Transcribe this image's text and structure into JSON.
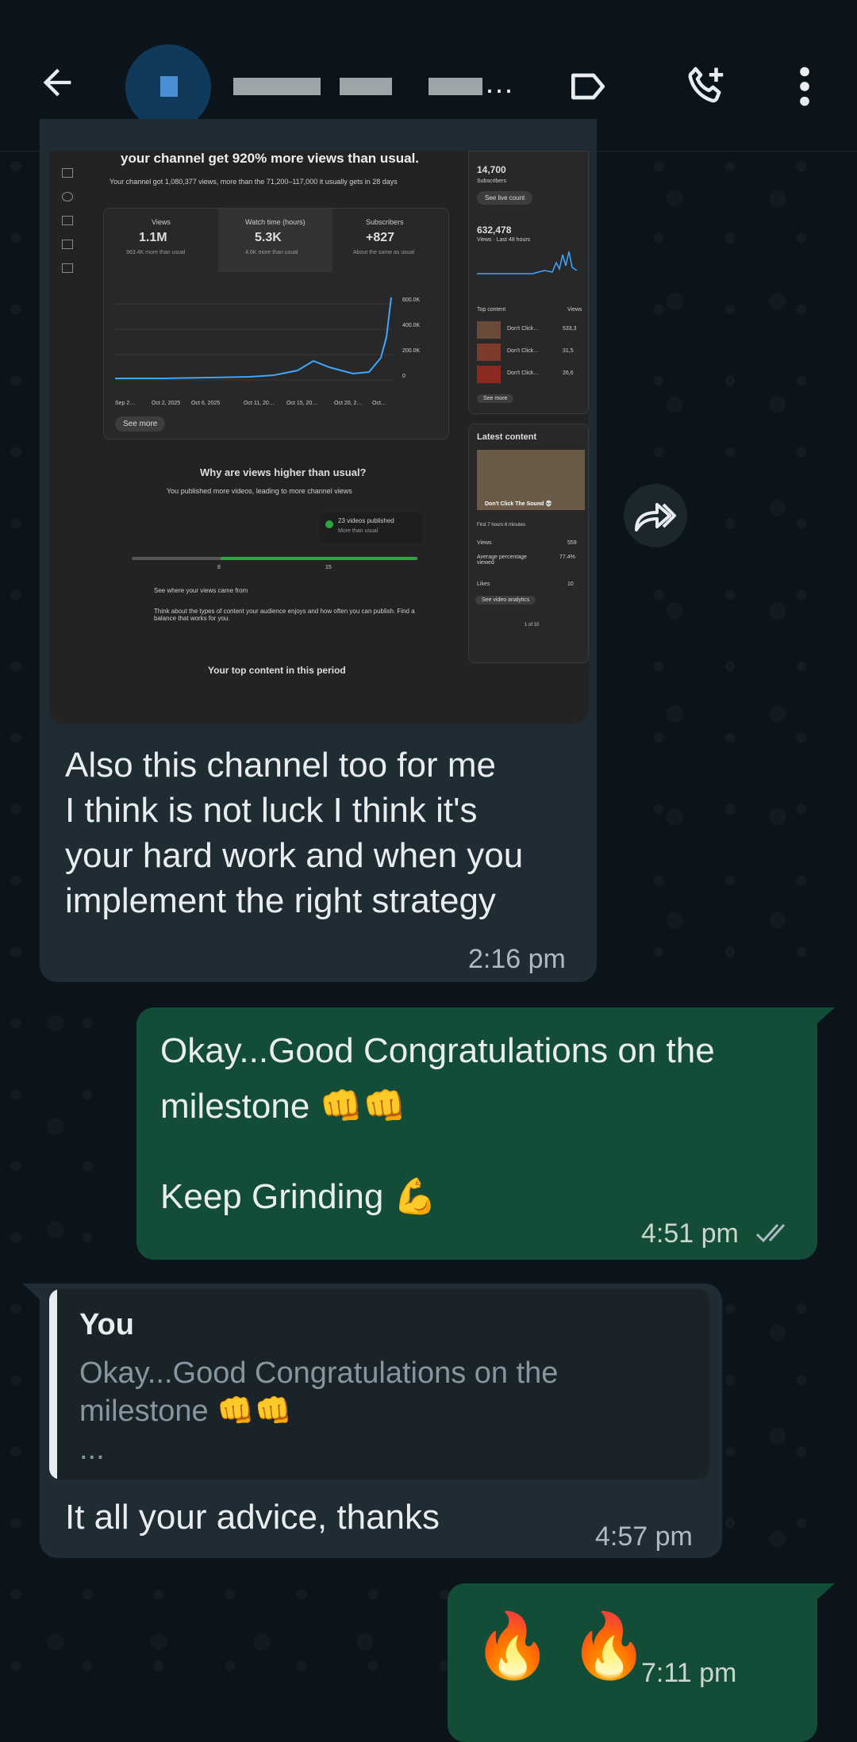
{
  "header": {
    "contact_name_suffix": "…"
  },
  "shared_screenshot": {
    "headline": "your channel get 920% more views than usual.",
    "subline": "Your channel got 1,080,377 views, more than the 71,200–117,000 it usually gets in 28 days",
    "stats": [
      {
        "label": "Views",
        "value": "1.1M",
        "sub": "963.4K more than usual"
      },
      {
        "label": "Watch time (hours)",
        "value": "5.3K",
        "sub": "4.6K more than usual"
      },
      {
        "label": "Subscribers",
        "value": "+827",
        "sub": "About the same as usual"
      }
    ],
    "y_ticks": [
      "600.0K",
      "400.0K",
      "200.0K",
      "0"
    ],
    "x_ticks": [
      "Sep 2…",
      "Oct 2, 2025",
      "Oct 6, 2025",
      "Oct 11, 20…",
      "Oct 15, 20…",
      "Oct 20, 2…",
      "Oct…"
    ],
    "see_more": "See more",
    "why_title": "Why are views higher than usual?",
    "why_sub": "You published more videos, leading to more channel views",
    "videos_published": "23 videos published",
    "more_than_usual": "More than usual",
    "scale_low": "8",
    "scale_high": "15",
    "tip1": "See where your views came from",
    "tip2": "Think about the types of content your audience enjoys and how often you can publish. Find a balance that works for you.",
    "top_content_title": "Your top content in this period",
    "right_subs": "14,700",
    "right_subs_label": "Subscribers",
    "see_live_count": "See live count",
    "right_views": "632,478",
    "right_views_label": "Views · Last 48 hours",
    "top_content": "Top content",
    "views_col": "Views",
    "top_rows": [
      {
        "title": "Don't Click…",
        "views": "533,3"
      },
      {
        "title": "Don't Click…",
        "views": "31,5"
      },
      {
        "title": "Don't Click…",
        "views": "26,6"
      }
    ],
    "right_see_more": "See more",
    "latest_content": "Latest content",
    "latest_video_title": "Don't Click The Sound 💀",
    "first_hours": "First 7 hours 6 minutes",
    "latest_stats": [
      {
        "label": "Views",
        "value": "559"
      },
      {
        "label": "Average percentage viewed",
        "value": "77.4%"
      },
      {
        "label": "Likes",
        "value": "10"
      }
    ],
    "see_video_analytics": "See video analytics",
    "pager": "1 of 10"
  },
  "messages": [
    {
      "id": "m1",
      "text_lines": [
        "Also this channel too for me",
        "I think is not luck I think it's",
        "your hard work and when you",
        "implement the right strategy"
      ],
      "time": "2:16 pm",
      "direction": "in"
    },
    {
      "id": "m2",
      "line1": "Okay...Good Congratulations on the",
      "line2": "milestone 👊👊",
      "line3": "Keep Grinding 💪",
      "time": "4:51 pm",
      "status": "read",
      "direction": "out"
    },
    {
      "id": "m3",
      "quote_author": "You",
      "quote_line1": "Okay...Good Congratulations on the",
      "quote_line2": "milestone 👊👊",
      "quote_more": "...",
      "text": "It all your advice, thanks",
      "time": "4:57 pm",
      "direction": "in"
    },
    {
      "id": "m4",
      "text": "🔥 🔥",
      "time": "7:11 pm",
      "direction": "out"
    }
  ],
  "colors": {
    "background": "#0b141a",
    "incoming_bubble": "#202c33",
    "outgoing_bubble": "#144d37",
    "read_ticks": "#aebac1"
  },
  "icons": [
    "back-arrow-icon",
    "label-icon",
    "add-call-icon",
    "more-vert-icon",
    "forward-icon",
    "double-check-icon"
  ]
}
